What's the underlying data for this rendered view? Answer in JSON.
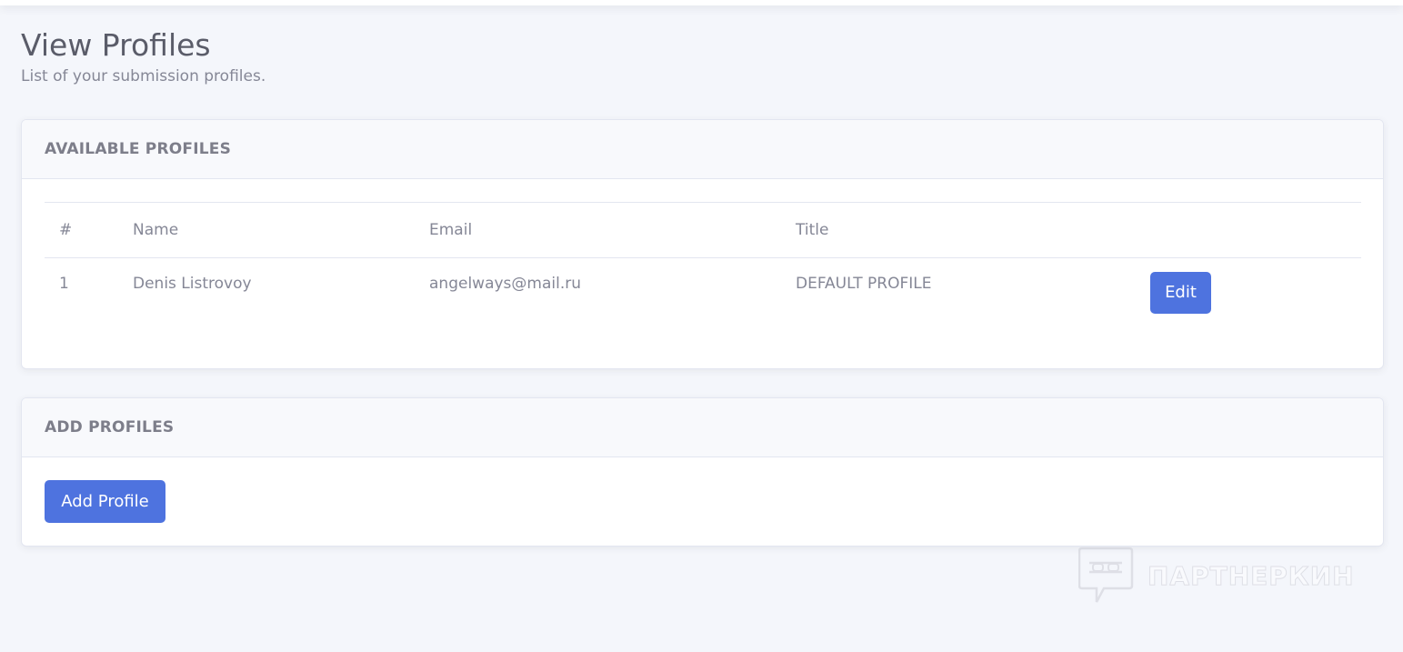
{
  "page": {
    "title": "View Profiles",
    "subtitle": "List of your submission profiles."
  },
  "available_profiles": {
    "header": "AVAILABLE PROFILES",
    "columns": [
      "#",
      "Name",
      "Email",
      "Title",
      ""
    ],
    "rows": [
      {
        "num": "1",
        "name": "Denis Listrovoy",
        "email": "angelways@mail.ru",
        "title": "DEFAULT PROFILE",
        "action": "Edit"
      }
    ]
  },
  "add_profiles": {
    "header": "ADD PROFILES",
    "button": "Add Profile"
  },
  "watermark": {
    "text": "ПАРТНЕРКИН",
    "icon": "chat-bubble-mask-icon"
  },
  "colors": {
    "primary": "#4e73df",
    "background": "#f4f6fb",
    "card_header": "#f8f9fc"
  }
}
